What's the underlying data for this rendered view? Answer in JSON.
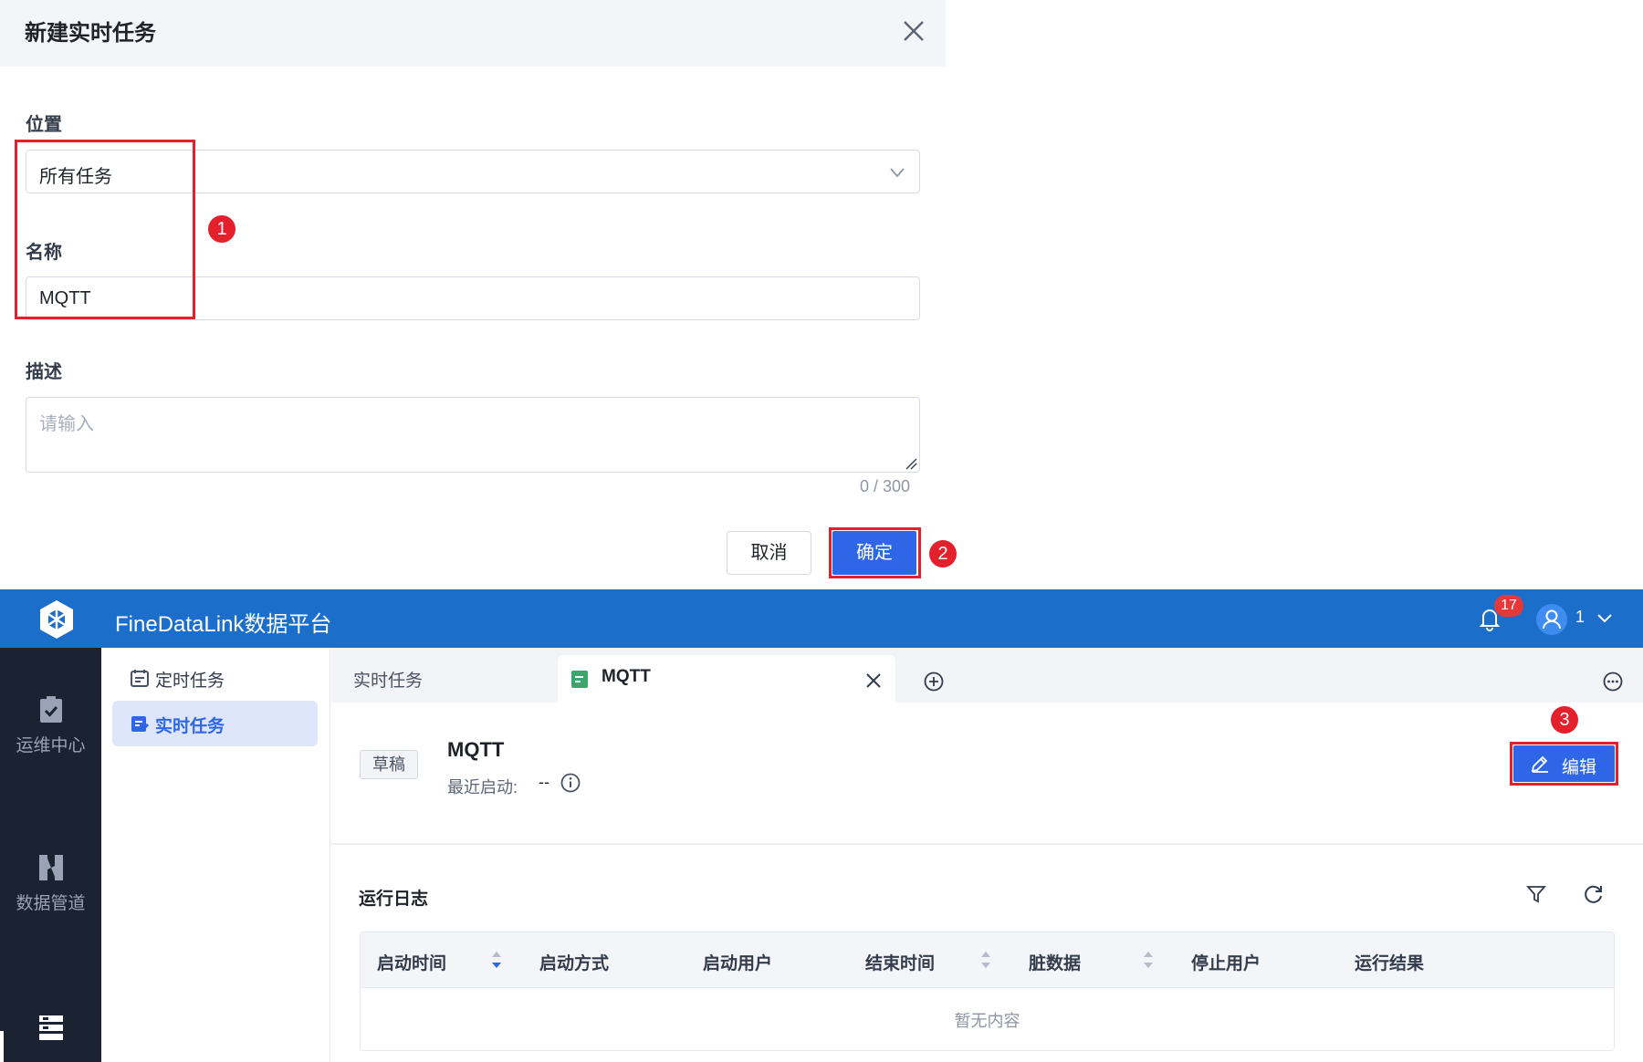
{
  "dialog": {
    "title": "新建实时任务",
    "location_label": "位置",
    "location_value": "所有任务",
    "name_label": "名称",
    "name_value": "MQTT",
    "desc_label": "描述",
    "desc_placeholder": "请输入",
    "desc_counter": "0 / 300",
    "cancel_label": "取消",
    "ok_label": "确定"
  },
  "annotations": {
    "step1": "1",
    "step2": "2",
    "step3": "3",
    "highlight_color": "#e5202d"
  },
  "app": {
    "title": "FineDataLink数据平台",
    "notification_count": "17",
    "user_name": "1",
    "nav": [
      {
        "label": "运维中心"
      },
      {
        "label": "数据管道"
      }
    ],
    "sidebar": [
      {
        "label": "定时任务"
      },
      {
        "label": "实时任务"
      }
    ],
    "tabs": [
      {
        "label": "实时任务"
      },
      {
        "label": "MQTT"
      }
    ],
    "task": {
      "status_tag": "草稿",
      "name": "MQTT",
      "recent_start_label": "最近启动:",
      "recent_start_value": "--",
      "edit_label": "编辑"
    },
    "log": {
      "title": "运行日志",
      "columns": [
        "启动时间",
        "启动方式",
        "启动用户",
        "结束时间",
        "脏数据",
        "停止用户",
        "运行结果"
      ],
      "empty_text": "暂无内容"
    },
    "colors": {
      "brand": "#1b6fcb",
      "primary": "#2f66e8",
      "nav_bg": "#1b2232"
    }
  }
}
